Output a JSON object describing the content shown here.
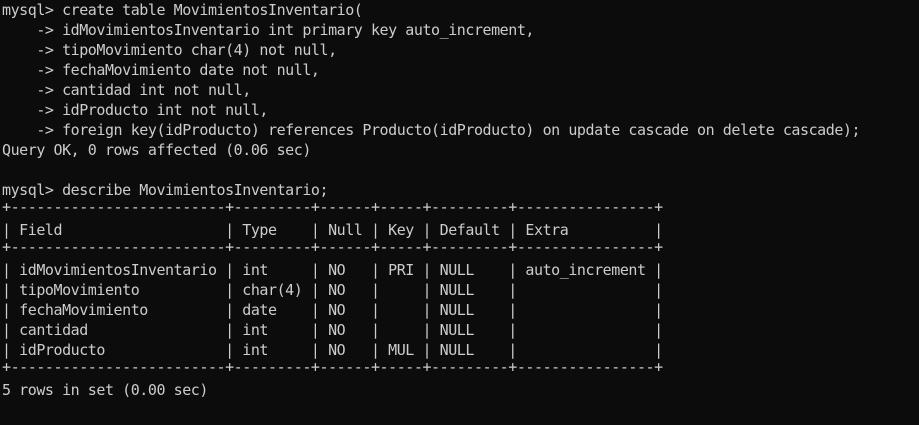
{
  "terminal": {
    "lines": [
      "mysql> create table MovimientosInventario(",
      "    -> idMovimientosInventario int primary key auto_increment,",
      "    -> tipoMovimiento char(4) not null,",
      "    -> fechaMovimiento date not null,",
      "    -> cantidad int not null,",
      "    -> idProducto int not null,",
      "    -> foreign key(idProducto) references Producto(idProducto) on update cascade on delete cascade);",
      "Query OK, 0 rows affected (0.06 sec)",
      "",
      "mysql> describe MovimientosInventario;",
      "+-------------------------+---------+------+-----+---------+----------------+",
      "| Field                   | Type    | Null | Key | Default | Extra          |",
      "+-------------------------+---------+------+-----+---------+----------------+",
      "| idMovimientosInventario | int     | NO   | PRI | NULL    | auto_increment |",
      "| tipoMovimiento          | char(4) | NO   |     | NULL    |                |",
      "| fechaMovimiento         | date    | NO   |     | NULL    |                |",
      "| cantidad                | int     | NO   |     | NULL    |                |",
      "| idProducto              | int     | NO   | MUL | NULL    |                |",
      "+-------------------------+---------+------+-----+---------+----------------+",
      "5 rows in set (0.00 sec)"
    ]
  },
  "colors": {
    "background": "#0c0c0c",
    "text": "#cccccc"
  }
}
